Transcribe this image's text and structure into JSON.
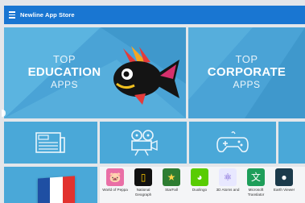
{
  "appbar": {
    "title": "Newline App Store"
  },
  "banners": {
    "education": {
      "top": "TOP",
      "main": "EDUCATION",
      "apps": "APPS"
    },
    "corporate": {
      "top": "TOP",
      "main": "CORPORATE",
      "apps": "APPS"
    }
  },
  "categories": [
    {
      "icon": "news-icon",
      "label": ""
    },
    {
      "icon": "film-camera-icon",
      "label": ""
    },
    {
      "icon": "gamepad-icon",
      "label": ""
    },
    {
      "icon": "partial-icon",
      "label": ""
    }
  ],
  "language_tile": {
    "icon": "france-flag-icon"
  },
  "apps": [
    {
      "label": "World of Peppa",
      "icon": "peppa-icon",
      "bg": "#e96fa6",
      "glyph": "🐷"
    },
    {
      "label": "National Geograph",
      "icon": "national-geographic-icon",
      "bg": "#111111",
      "glyph": "▯"
    },
    {
      "label": "StarFall",
      "icon": "starfall-icon",
      "bg": "#2e7d32",
      "glyph": "★"
    },
    {
      "label": "Duolingo",
      "icon": "duolingo-icon",
      "bg": "#58cc02",
      "glyph": "◕"
    },
    {
      "label": "3D Atoms and",
      "icon": "atoms-icon",
      "bg": "#e8e8ff",
      "glyph": "⚛"
    },
    {
      "label": "Microsoft Translator",
      "icon": "translator-icon",
      "bg": "#1e9e5a",
      "glyph": "文"
    },
    {
      "label": "Earth Viewer",
      "icon": "earth-icon",
      "bg": "#1b3a4b",
      "glyph": "●"
    }
  ]
}
